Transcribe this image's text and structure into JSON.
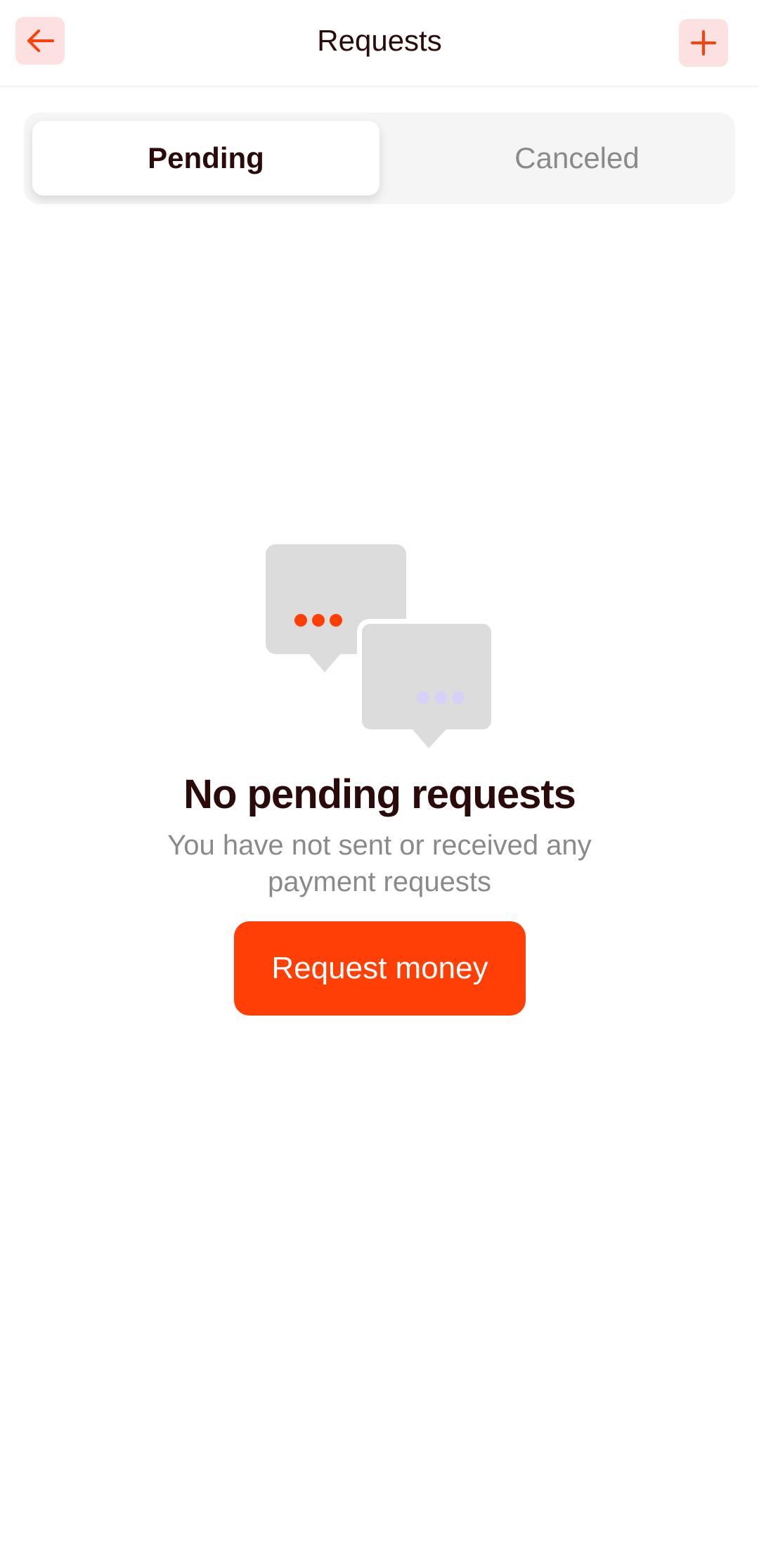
{
  "header": {
    "title": "Requests",
    "back_icon": "arrow-left-icon",
    "add_icon": "plus-icon"
  },
  "tabs": [
    {
      "label": "Pending",
      "selected": true
    },
    {
      "label": "Canceled",
      "selected": false
    }
  ],
  "empty_state": {
    "illustration_icon": "chat-bubbles-icon",
    "title": "No pending requests",
    "subtitle": "You have not sent or received any payment requests",
    "button_label": "Request money"
  },
  "colors": {
    "accent": "#ff3f05",
    "icon_button_bg": "#fde0e0",
    "title_text": "#2b0a0a",
    "muted_text": "#8a8a8a",
    "bubble_gray": "#dcdcdc",
    "dot_lavender": "#d7d0f7"
  }
}
